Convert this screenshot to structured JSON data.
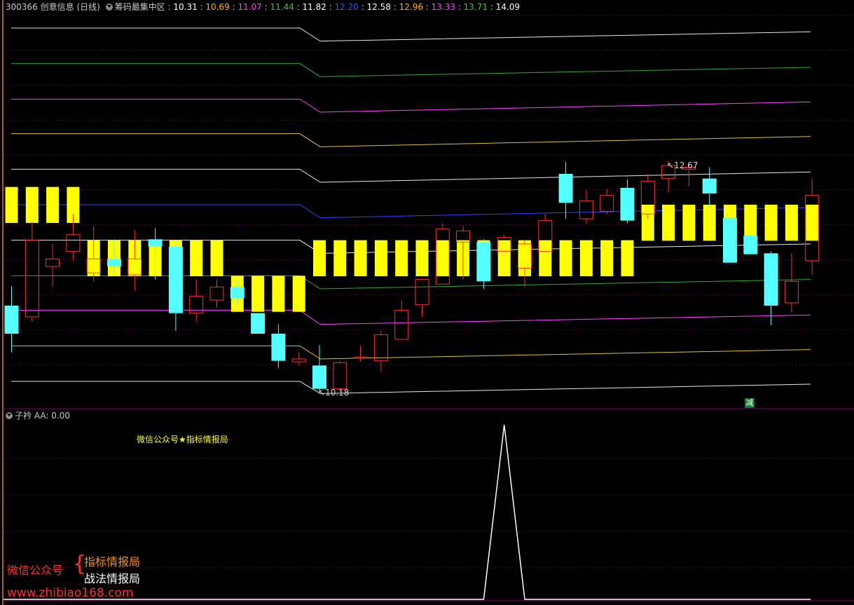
{
  "header": {
    "code": "300366",
    "name": "创意信息",
    "period": "(日线)",
    "indicator": "筹码最集中区",
    "levels": [
      {
        "value": "10.31",
        "color": "#ffffff"
      },
      {
        "value": "10.69",
        "color": "#ffb000"
      },
      {
        "value": "11.07",
        "color": "#ff44ff"
      },
      {
        "value": "11.44",
        "color": "#33cc33"
      },
      {
        "value": "11.82",
        "color": "#ffffff"
      },
      {
        "value": "12.20",
        "color": "#3355ff"
      },
      {
        "value": "12.58",
        "color": "#ffffff"
      },
      {
        "value": "12.96",
        "color": "#ffb000"
      },
      {
        "value": "13.33",
        "color": "#ff44ff"
      },
      {
        "value": "13.71",
        "color": "#33cc33"
      },
      {
        "value": "14.09",
        "color": "#ffffff"
      }
    ]
  },
  "sub_header": {
    "name": "子衿",
    "value_label": "AA: 0.00"
  },
  "annotations": {
    "high": "12.67",
    "low": "10.18",
    "signal_badge": "减",
    "note": "微信公众号★指标情报局"
  },
  "watermark": {
    "left": "微信公众号",
    "brace": "{",
    "right1": "指标情报局",
    "right2": "战法情报局",
    "url": "www.zhibiao168.com"
  },
  "colors": {
    "up": "#ff3030",
    "down": "#55ffff",
    "band": "#ffff00",
    "separator": "#800080"
  },
  "chart_data": [
    {
      "type": "candlestick",
      "yrange": [
        10.1,
        14.2
      ],
      "candles": [
        {
          "o": 11.12,
          "h": 11.33,
          "l": 10.62,
          "c": 10.82
        },
        {
          "o": 11.0,
          "h": 12.02,
          "l": 10.95,
          "c": 11.82
        },
        {
          "o": 11.54,
          "h": 11.78,
          "l": 11.32,
          "c": 11.62
        },
        {
          "o": 11.7,
          "h": 12.1,
          "l": 11.6,
          "c": 11.88
        },
        {
          "o": 11.47,
          "h": 11.97,
          "l": 11.38,
          "c": 11.62
        },
        {
          "o": 11.62,
          "h": 11.83,
          "l": 11.45,
          "c": 11.54
        },
        {
          "o": 11.45,
          "h": 11.93,
          "l": 11.28,
          "c": 11.62
        },
        {
          "o": 11.83,
          "h": 11.95,
          "l": 11.4,
          "c": 11.75
        },
        {
          "o": 11.75,
          "h": 11.79,
          "l": 10.85,
          "c": 11.04
        },
        {
          "o": 11.04,
          "h": 11.4,
          "l": 10.95,
          "c": 11.22
        },
        {
          "o": 11.18,
          "h": 11.4,
          "l": 11.1,
          "c": 11.32
        },
        {
          "o": 11.32,
          "h": 11.38,
          "l": 11.13,
          "c": 11.2
        },
        {
          "o": 11.04,
          "h": 11.04,
          "l": 10.82,
          "c": 10.82
        },
        {
          "o": 10.82,
          "h": 10.92,
          "l": 10.45,
          "c": 10.53
        },
        {
          "o": 10.52,
          "h": 10.62,
          "l": 10.48,
          "c": 10.55
        },
        {
          "o": 10.48,
          "h": 10.7,
          "l": 10.2,
          "c": 10.23
        },
        {
          "o": 10.23,
          "h": 10.53,
          "l": 10.18,
          "c": 10.51
        },
        {
          "o": 10.56,
          "h": 10.69,
          "l": 10.52,
          "c": 10.57
        },
        {
          "o": 10.53,
          "h": 10.85,
          "l": 10.41,
          "c": 10.81
        },
        {
          "o": 10.76,
          "h": 11.18,
          "l": 10.76,
          "c": 11.07
        },
        {
          "o": 11.13,
          "h": 11.4,
          "l": 11.0,
          "c": 11.4
        },
        {
          "o": 11.35,
          "h": 12.0,
          "l": 11.35,
          "c": 11.94
        },
        {
          "o": 11.8,
          "h": 11.97,
          "l": 11.4,
          "c": 11.92
        },
        {
          "o": 11.8,
          "h": 11.83,
          "l": 11.3,
          "c": 11.38
        },
        {
          "o": 11.7,
          "h": 11.88,
          "l": 11.7,
          "c": 11.85
        },
        {
          "o": 11.52,
          "h": 11.82,
          "l": 11.32,
          "c": 11.78
        },
        {
          "o": 11.7,
          "h": 12.1,
          "l": 11.7,
          "c": 12.03
        },
        {
          "o": 12.53,
          "h": 12.66,
          "l": 12.05,
          "c": 12.22
        },
        {
          "o": 12.05,
          "h": 12.36,
          "l": 12.0,
          "c": 12.24
        },
        {
          "o": 12.13,
          "h": 12.37,
          "l": 12.1,
          "c": 12.3
        },
        {
          "o": 12.38,
          "h": 12.47,
          "l": 12.0,
          "c": 12.03
        },
        {
          "o": 12.1,
          "h": 12.53,
          "l": 12.05,
          "c": 12.45
        },
        {
          "o": 12.48,
          "h": 12.67,
          "l": 12.33,
          "c": 12.62
        },
        {
          "o": 12.58,
          "h": 12.65,
          "l": 12.4,
          "c": 12.6
        },
        {
          "o": 12.48,
          "h": 12.6,
          "l": 12.18,
          "c": 12.32
        },
        {
          "o": 12.06,
          "h": 12.06,
          "l": 11.58,
          "c": 11.58
        },
        {
          "o": 11.87,
          "h": 11.87,
          "l": 11.67,
          "c": 11.67
        },
        {
          "o": 11.68,
          "h": 11.7,
          "l": 10.91,
          "c": 11.12
        },
        {
          "o": 11.15,
          "h": 11.68,
          "l": 11.05,
          "c": 11.38
        },
        {
          "o": 11.6,
          "h": 12.48,
          "l": 11.45,
          "c": 12.3
        }
      ],
      "bands": [
        {
          "level": 12.39,
          "bars": [
            0,
            1,
            2,
            3
          ]
        },
        {
          "level": 11.82,
          "bars": [
            4,
            5,
            6,
            7,
            8,
            9,
            10
          ]
        },
        {
          "level": 11.44,
          "bars": [
            11,
            12,
            13,
            14
          ]
        },
        {
          "level": 11.82,
          "bars": [
            15,
            16,
            17,
            18,
            19,
            20,
            21,
            22,
            23,
            24,
            25,
            26,
            27,
            28,
            29,
            30
          ]
        },
        {
          "level": 12.2,
          "bars": [
            31,
            32,
            33,
            34,
            35,
            36,
            37,
            38,
            39
          ]
        }
      ],
      "levels": [
        {
          "name": "c1",
          "color": "#e8e8e8",
          "values": [
            10.31,
            10.31,
            10.18,
            10.28
          ]
        },
        {
          "name": "c2",
          "color": "#e0c040",
          "values": [
            10.69,
            10.69,
            10.55,
            10.65
          ]
        },
        {
          "name": "c3",
          "color": "#ff44ff",
          "values": [
            11.07,
            11.07,
            10.92,
            11.02
          ]
        },
        {
          "name": "c4",
          "color": "#33aa33",
          "values": [
            11.44,
            11.44,
            11.3,
            11.4
          ]
        },
        {
          "name": "c5",
          "color": "#e8e8e8",
          "values": [
            11.82,
            11.82,
            11.68,
            11.78
          ]
        },
        {
          "name": "c6",
          "color": "#3344ff",
          "values": [
            12.2,
            12.2,
            12.06,
            12.17
          ]
        },
        {
          "name": "c7",
          "color": "#e8e8e8",
          "values": [
            12.58,
            12.58,
            12.44,
            12.55
          ]
        },
        {
          "name": "c8",
          "color": "#e0c040",
          "values": [
            12.96,
            12.96,
            12.82,
            12.93
          ]
        },
        {
          "name": "c9",
          "color": "#ff44ff",
          "values": [
            13.33,
            13.33,
            13.19,
            13.3
          ]
        },
        {
          "name": "c10",
          "color": "#33aa33",
          "values": [
            13.71,
            13.71,
            13.57,
            13.67
          ]
        },
        {
          "name": "c11",
          "color": "#e8e8e8",
          "values": [
            14.09,
            14.09,
            13.95,
            14.05
          ]
        }
      ]
    },
    {
      "type": "line",
      "series": [
        {
          "name": "AA",
          "values": [
            0,
            0,
            0,
            0,
            0,
            0,
            0,
            0,
            0,
            0,
            0,
            0,
            0,
            0,
            0,
            0,
            0,
            0,
            0,
            0,
            0,
            0,
            0,
            0,
            1,
            0,
            0,
            0,
            0,
            0,
            0,
            0,
            0,
            0,
            0,
            0,
            0,
            0,
            0,
            0
          ]
        }
      ],
      "ylim": [
        0,
        1
      ]
    }
  ]
}
